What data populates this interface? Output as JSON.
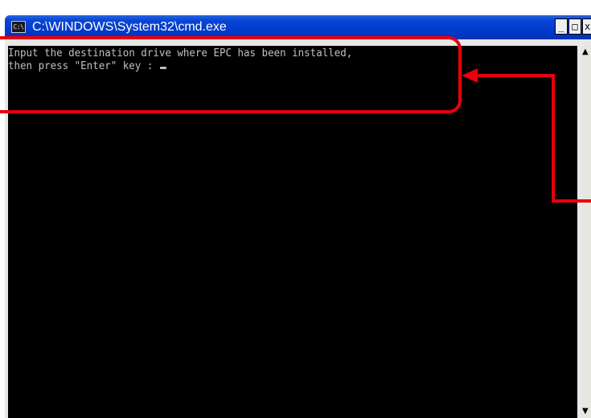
{
  "window": {
    "title": "C:\\WINDOWS\\System32\\cmd.exe",
    "icon_name": "cmd-icon",
    "icon_glyph": "C:\\",
    "buttons": {
      "minimize_glyph": "_",
      "maximize_glyph": "□",
      "close_glyph": "x"
    }
  },
  "console": {
    "line1": "Input the destination drive where EPC has been installed,",
    "line2": "then press \"Enter\" key : ",
    "cursor": "_",
    "background_color": "#000000",
    "text_color": "#c0c0c0"
  },
  "scrollbar": {
    "up_glyph": "▲",
    "down_glyph": "▼"
  },
  "annotation": {
    "callout_color": "#e8000b",
    "arrow_icon": "arrow-left-icon"
  }
}
